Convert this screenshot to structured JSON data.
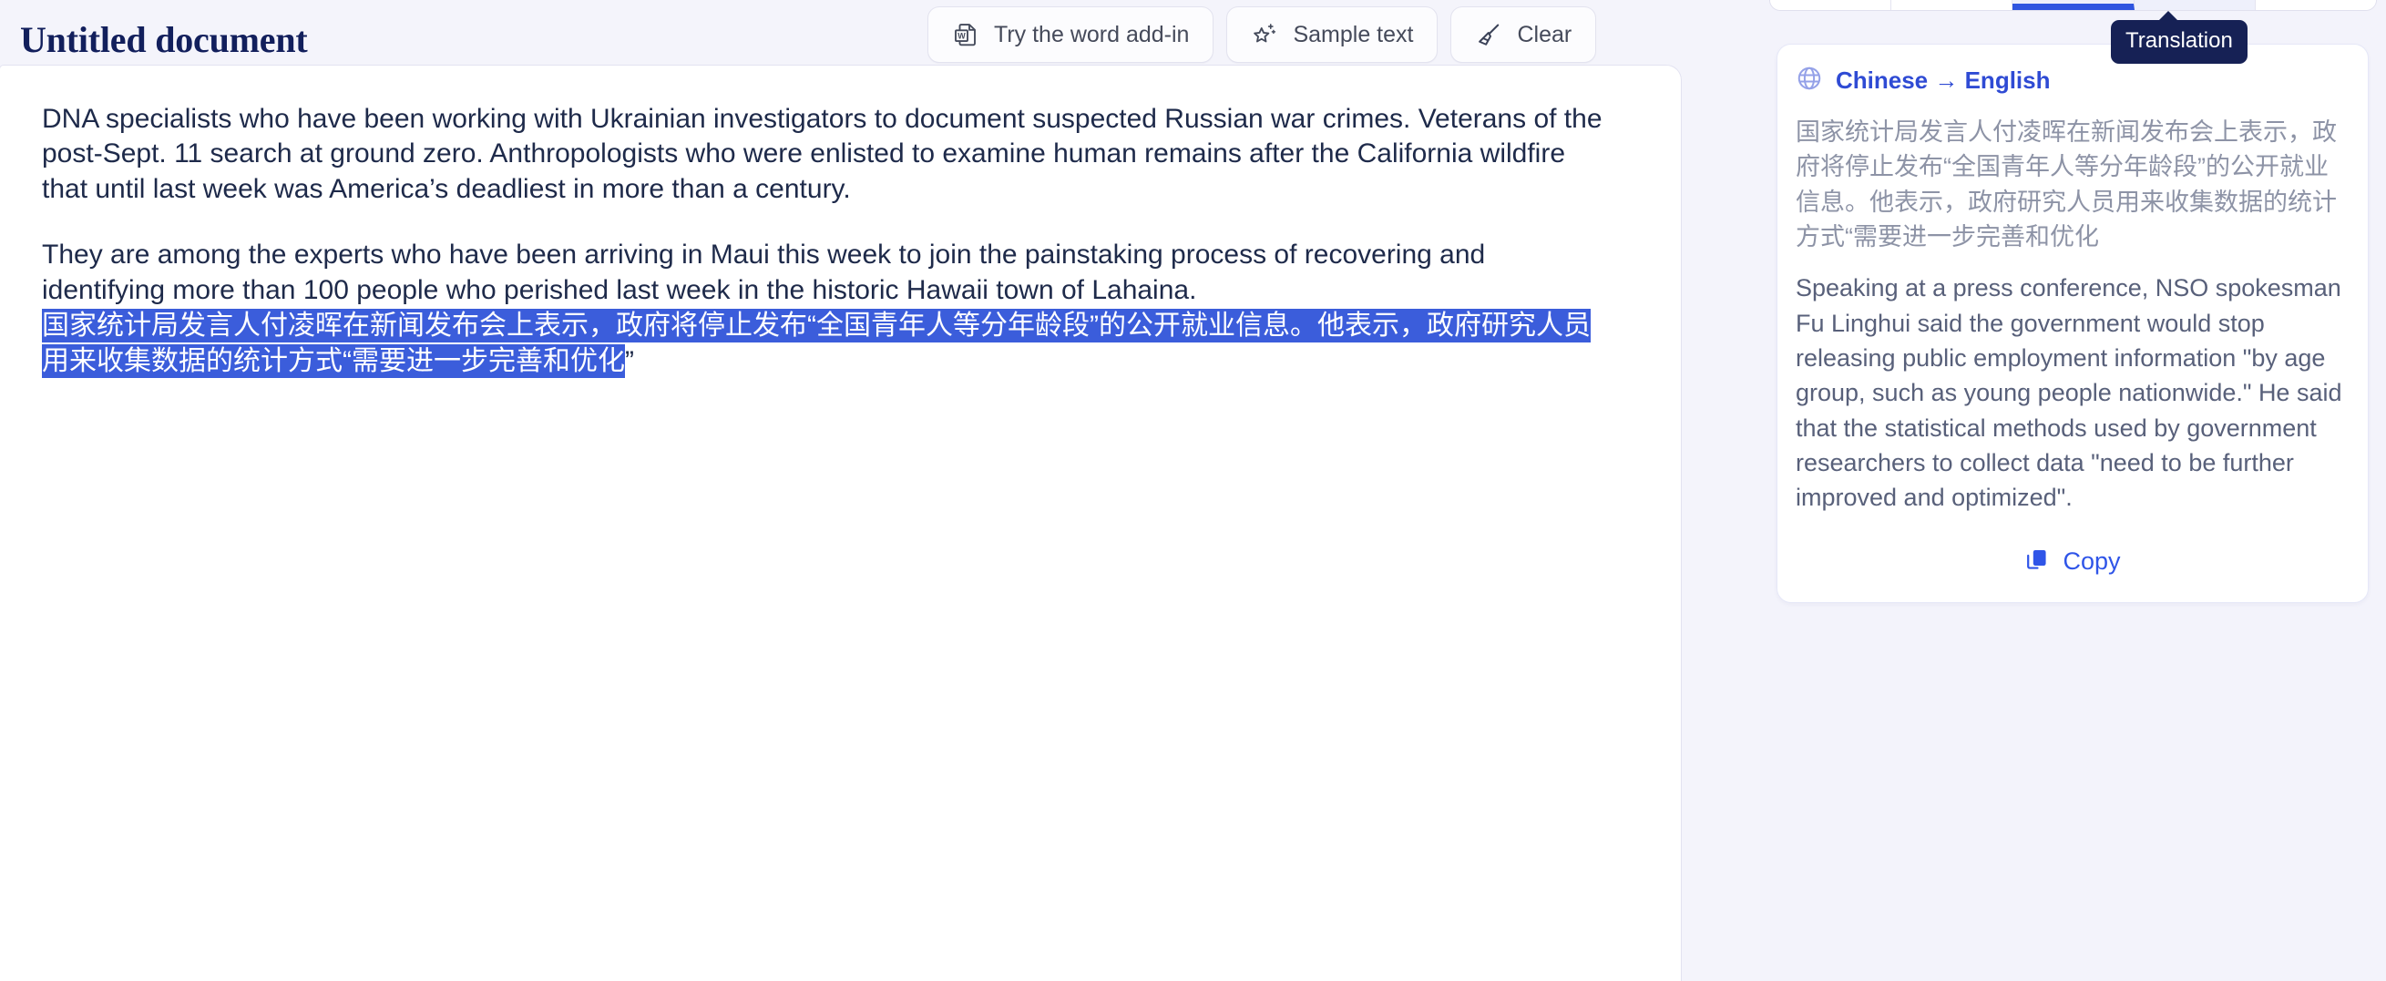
{
  "editor": {
    "title": "Untitled document",
    "toolbar": [
      {
        "id": "try-word-addin",
        "label": "Try the word add-in",
        "icon": "word-document-icon"
      },
      {
        "id": "sample-text",
        "label": "Sample text",
        "icon": "sparkle-star-icon"
      },
      {
        "id": "clear",
        "label": "Clear",
        "icon": "broom-icon"
      }
    ],
    "paragraphs": [
      {
        "id": "para-1",
        "selected": false,
        "text": "DNA specialists who have been working with Ukrainian investigators to document suspected Russian war crimes. Veterans of the post-Sept. 11 search at ground zero. Anthropologists who were enlisted to examine human remains after the California wildfire that until last week was America’s deadliest in more than a century."
      },
      {
        "id": "para-2",
        "selected": false,
        "text": "They are among the experts who have been arriving in Maui this week to join the painstaking process of recovering and identifying more than 100 people who perished last week in the historic Hawaii town of Lahaina."
      }
    ],
    "selected_text": "国家统计局发言人付凌晖在新闻发布会上表示，政府将停止发布“全国青年人等分年龄段”的公开就业信息。他表示，政府研究人员用来收集数据的统计方式“需要进一步完善和优化",
    "selected_text_trailing": "”"
  },
  "panel": {
    "tooltip": "Translation",
    "language_pair": "Chinese → English",
    "language_icon": "globe-icon",
    "source_text": "国家统计局发言人付凌晖在新闻发布会上表示，政府将停止发布“全国青年人等分年龄段”的公开就业信息。他表示，政府研究人员用来收集数据的统计方式“需要进一步完善和优化",
    "translated_text": "Speaking at a press conference, NSO spokesman Fu Linghui said the government would stop releasing public employment information \"by age group, such as young people nationwide.\" He said that the statistical methods used by government researchers to collect data \"need to be further improved and optimized\".",
    "copy_label": "Copy",
    "copy_icon": "copy-icon"
  },
  "colors": {
    "app_bg": "#f4f4fb",
    "title": "#121f5c",
    "selection_blue": "#3b5ddb",
    "accent_blue": "#2f55e8",
    "lang_blue": "#2f4bd4",
    "tooltip_bg": "#162155",
    "source_gray": "#8d93a6",
    "output_gray": "#58607a",
    "doc_text": "#1e2a4a"
  }
}
